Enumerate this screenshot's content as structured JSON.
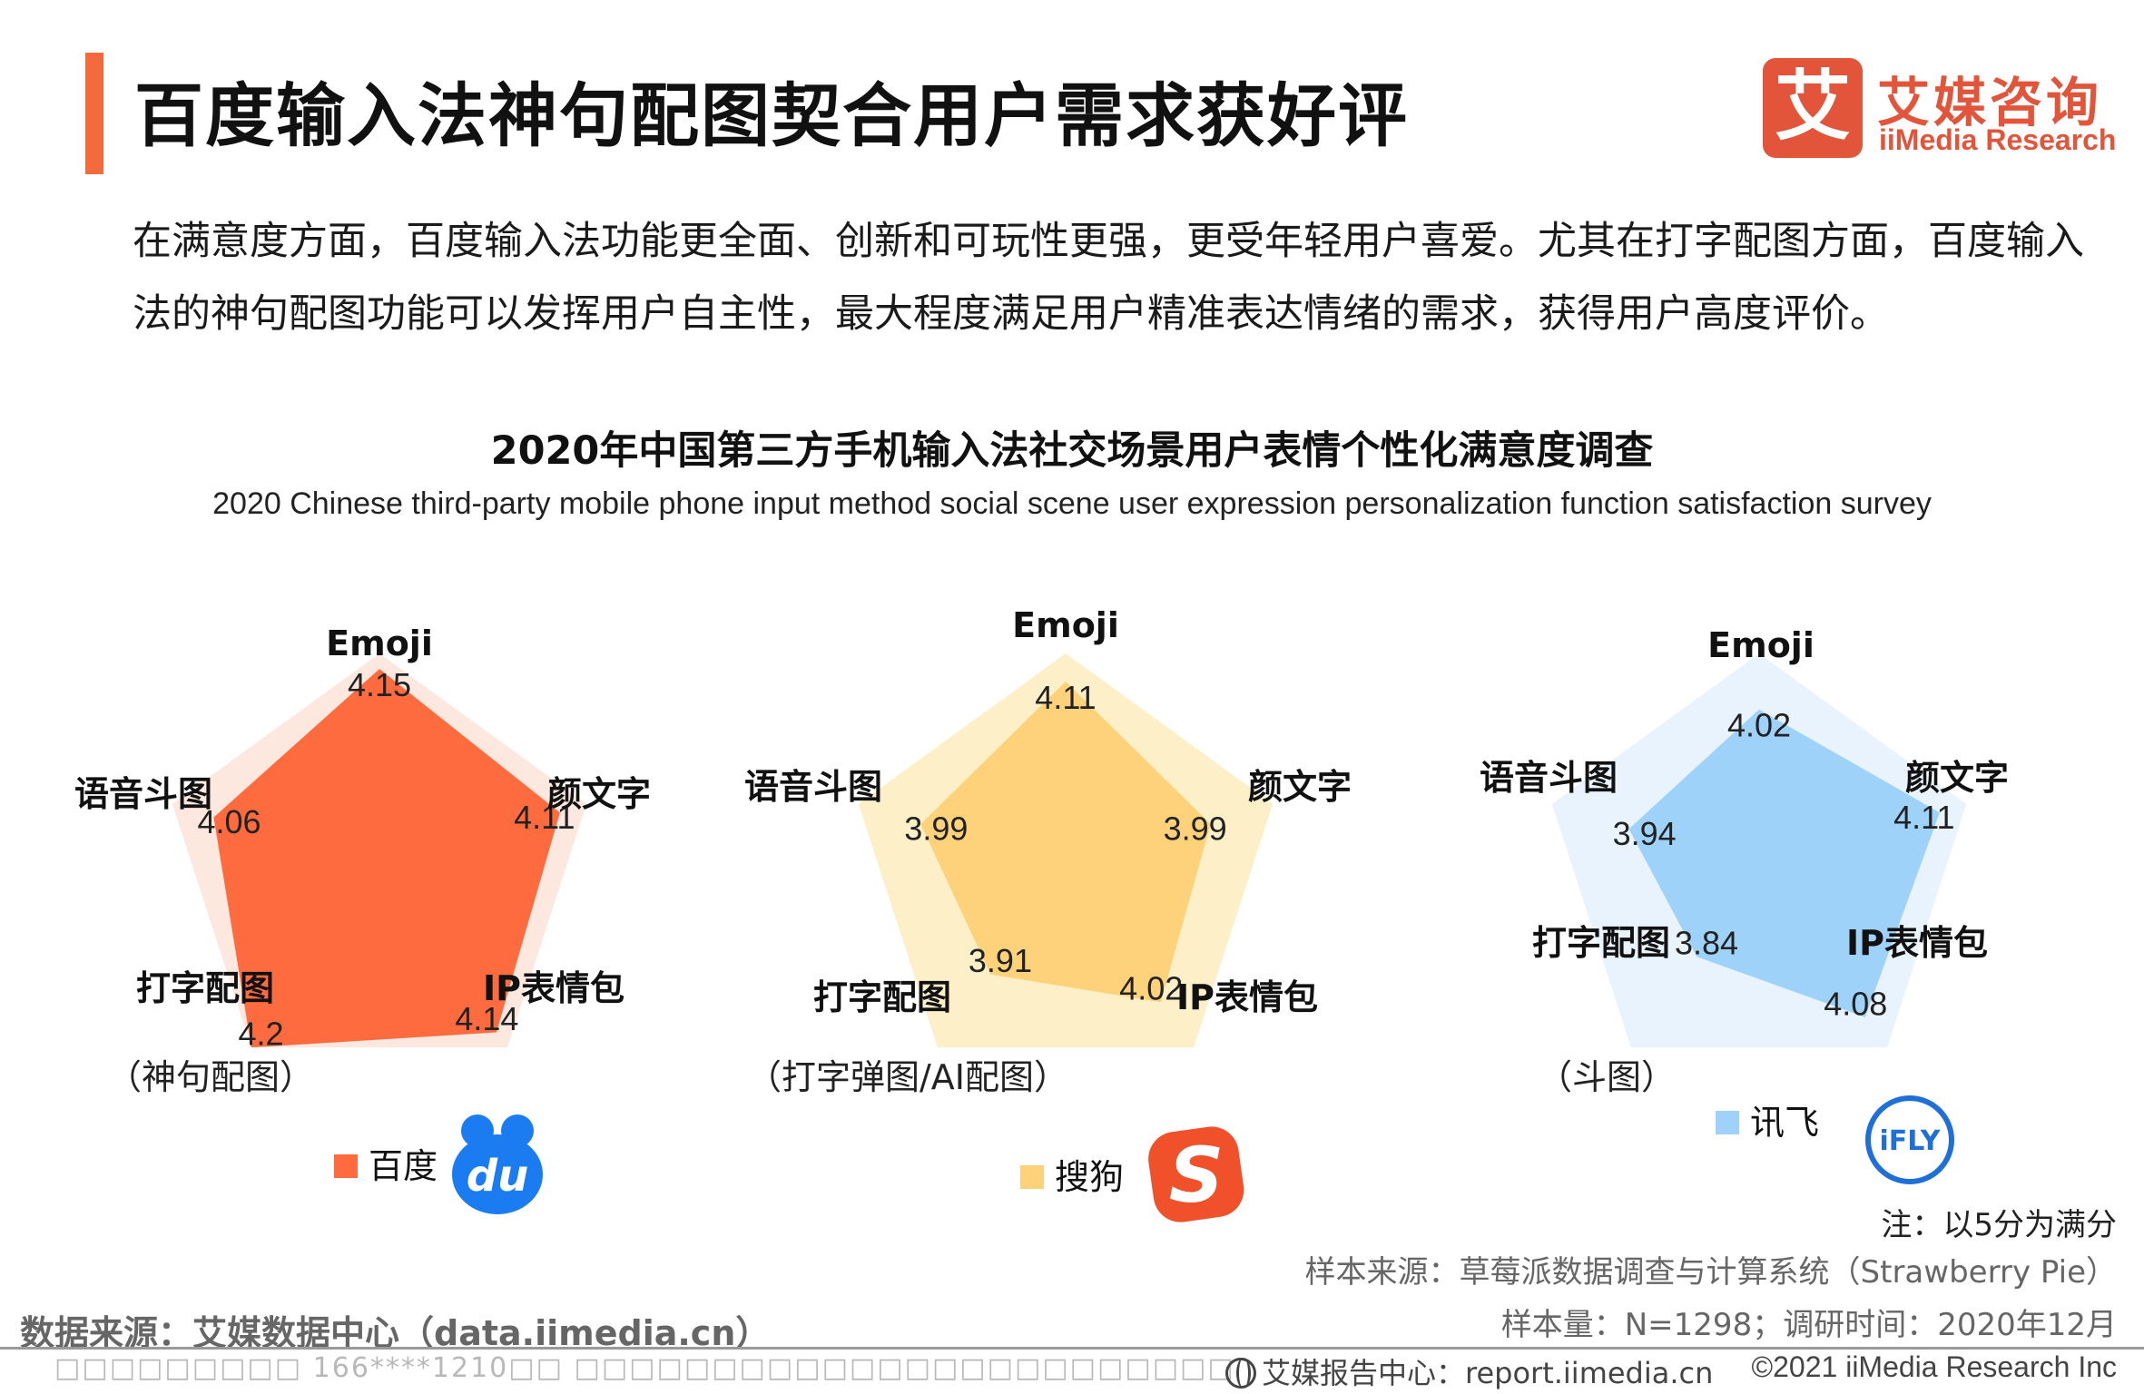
{
  "header": {
    "title": "百度输入法神句配图契合用户需求获好评",
    "brand_cn": "艾媒咨询",
    "brand_en": "iiMedia Research",
    "brand_logo_char": "艾"
  },
  "intro": "在满意度方面，百度输入法功能更全面、创新和可玩性更强，更受年轻用户喜爱。尤其在打字配图方面，百度输入法的神句配图功能可以发挥用户自主性，最大程度满足用户精准表达情绪的需求，获得用户高度评价。",
  "chart_data": [
    {
      "type": "radar",
      "title": "2020年中国第三方手机输入法社交场景用户表情个性化满意度调查",
      "subtitle": "2020 Chinese third-party mobile phone input method social scene user expression personalization function satisfaction survey",
      "axes": [
        "Emoji",
        "颜文字",
        "IP表情包",
        "打字配图",
        "语音斗图"
      ],
      "series": [
        {
          "name": "百度",
          "values": [
            4.15,
            4.11,
            4.14,
            4.2,
            4.06
          ],
          "color": "#fd6b3e"
        }
      ],
      "feature_note": "（神句配图）",
      "background_color": "#fde8e0",
      "logo_text": "du",
      "logo_color": "#1a7cf0"
    },
    {
      "type": "radar",
      "axes": [
        "Emoji",
        "颜文字",
        "IP表情包",
        "打字配图",
        "语音斗图"
      ],
      "series": [
        {
          "name": "搜狗",
          "values": [
            4.11,
            3.99,
            4.02,
            3.91,
            3.99
          ],
          "color": "#fdd27a"
        }
      ],
      "feature_note": "（打字弹图/AI配图）",
      "background_color": "#fdf0c8",
      "logo_text": "S",
      "logo_color": "#f0512a"
    },
    {
      "type": "radar",
      "axes": [
        "Emoji",
        "颜文字",
        "IP表情包",
        "打字配图",
        "语音斗图"
      ],
      "series": [
        {
          "name": "讯飞",
          "values": [
            4.02,
            4.11,
            4.08,
            3.84,
            3.94
          ],
          "color": "#9fd2f8"
        }
      ],
      "feature_note": "（斗图）",
      "background_color": "#e9f3fd",
      "logo_text": "iFLY",
      "logo_color": "#1e6fd8"
    }
  ],
  "notes": {
    "scale": "注：以5分为满分",
    "sample_source": "样本来源：草莓派数据调查与计算系统（Strawberry Pie）",
    "sample_size": "样本量：N=1298；调研时间：2020年12月",
    "data_source": "数据来源：艾媒数据中心（data.iimedia.cn）"
  },
  "footer": {
    "watermark": "□□□□□□□□□ 166****1210□□ □□□□□□□□□□□□□□□□□□□□□□□□",
    "report_center": "艾媒报告中心：report.iimedia.cn",
    "copyright": "©2021 iiMedia Research Inc"
  }
}
